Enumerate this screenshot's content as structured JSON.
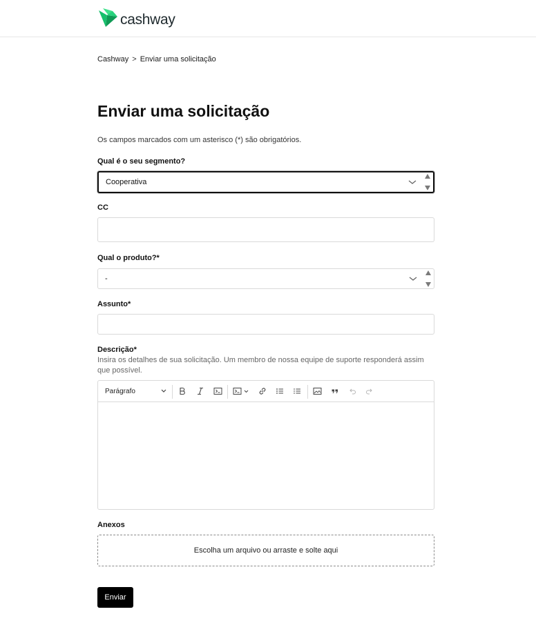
{
  "brand": {
    "name": "cashway",
    "accent_color": "#1fd37a",
    "logo_icon": "cashway-bird-logo"
  },
  "breadcrumb": {
    "items": [
      "Cashway",
      "Enviar uma solicitação"
    ],
    "separator": ">"
  },
  "page": {
    "title": "Enviar uma solicitação",
    "required_note": "Os campos marcados com um asterisco (*) são obrigatórios."
  },
  "form": {
    "segment": {
      "label": "Qual é o seu segmento?",
      "value": "Cooperativa"
    },
    "cc": {
      "label": "CC",
      "value": ""
    },
    "product": {
      "label": "Qual o produto?*",
      "value": "-"
    },
    "subject": {
      "label": "Assunto*",
      "value": ""
    },
    "description": {
      "label": "Descrição*",
      "hint": "Insira os detalhes de sua solicitação. Um membro de nossa equipe de suporte responderá assim que possível.",
      "toolbar": {
        "paragraph_label": "Parágrafo",
        "icons": [
          "bold-icon",
          "italic-icon",
          "code-icon",
          "code-block-icon",
          "link-icon",
          "bullet-list-icon",
          "numbered-list-icon",
          "image-icon",
          "quote-icon",
          "undo-icon",
          "redo-icon"
        ]
      },
      "value": ""
    },
    "attachments": {
      "label": "Anexos",
      "dropzone_text": "Escolha um arquivo ou arraste e solte aqui"
    },
    "submit_label": "Enviar"
  }
}
